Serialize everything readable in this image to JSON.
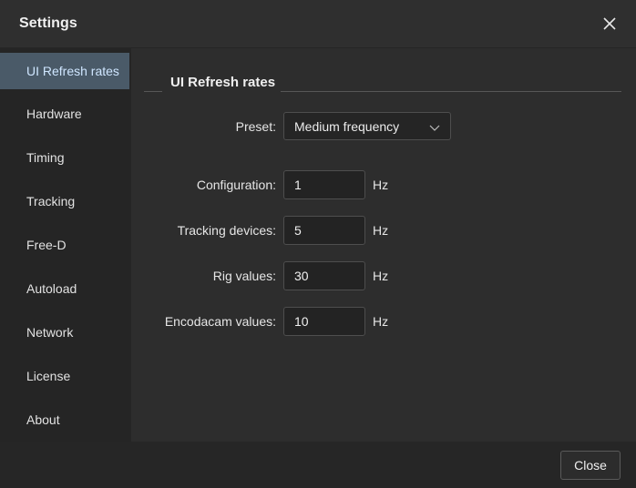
{
  "window": {
    "title": "Settings"
  },
  "sidebar": {
    "items": [
      {
        "label": "UI Refresh rates",
        "active": true
      },
      {
        "label": "Hardware",
        "active": false
      },
      {
        "label": "Timing",
        "active": false
      },
      {
        "label": "Tracking",
        "active": false
      },
      {
        "label": "Free-D",
        "active": false
      },
      {
        "label": "Autoload",
        "active": false
      },
      {
        "label": "Network",
        "active": false
      },
      {
        "label": "License",
        "active": false
      },
      {
        "label": "About",
        "active": false
      }
    ]
  },
  "main": {
    "group_title": "UI Refresh rates",
    "preset": {
      "label": "Preset:",
      "value": "Medium frequency"
    },
    "rates": [
      {
        "label": "Configuration:",
        "value": "1",
        "unit": "Hz"
      },
      {
        "label": "Tracking devices:",
        "value": "5",
        "unit": "Hz"
      },
      {
        "label": "Rig values:",
        "value": "30",
        "unit": "Hz"
      },
      {
        "label": "Encodacam values:",
        "value": "10",
        "unit": "Hz"
      }
    ]
  },
  "footer": {
    "close_label": "Close"
  },
  "colors": {
    "active_item_bg": "#4a5a68",
    "active_item_text": "#cfe6ff",
    "window_bg": "#2e2e2e",
    "sidebar_bg": "#252525"
  }
}
